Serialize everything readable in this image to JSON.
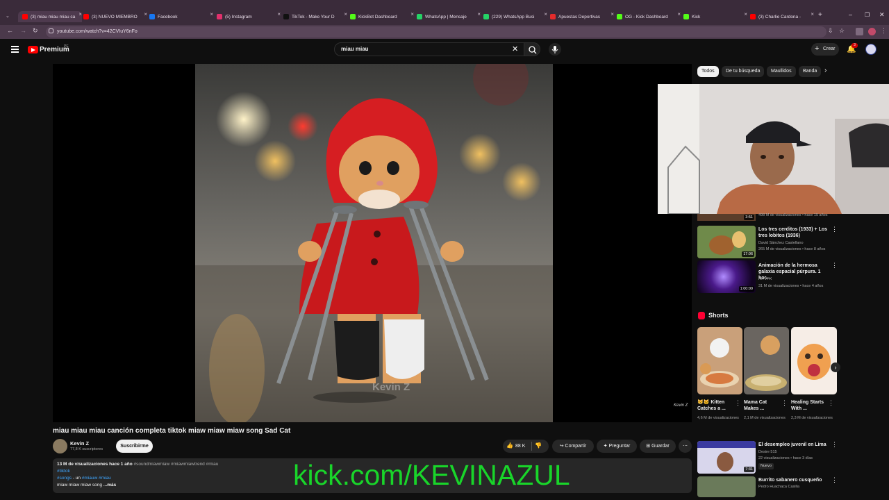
{
  "browser": {
    "tabs": [
      {
        "label": "(3) miau miau miau ca",
        "color": "#ff0000",
        "active": true
      },
      {
        "label": "(3) NUEVO MIEMBRO",
        "color": "#ff0000"
      },
      {
        "label": "Facebook",
        "color": "#1877f2"
      },
      {
        "label": "(5) Instagram",
        "color": "#e1306c"
      },
      {
        "label": "TikTok - Make Your D",
        "color": "#111111"
      },
      {
        "label": "KickBot Dashboard",
        "color": "#53fc18"
      },
      {
        "label": "WhatsApp | Mensaje",
        "color": "#25d366"
      },
      {
        "label": "(229) WhatsApp Busi",
        "color": "#25d366"
      },
      {
        "label": "Apuestas Deportivas",
        "color": "#e52b2b"
      },
      {
        "label": "OG - Kick Dashboard",
        "color": "#53fc18"
      },
      {
        "label": "Kick",
        "color": "#53fc18"
      },
      {
        "label": "(3) Charlie Cardona -",
        "color": "#ff0000"
      }
    ],
    "url": "youtube.com/watch?v=42CVIuY6nFo"
  },
  "header": {
    "logo_text": "Premium",
    "country": "PE",
    "search_value": "miau miau",
    "create_label": "Crear",
    "notif_count": "3"
  },
  "player": {
    "watermark": "Kevin Z"
  },
  "chips": [
    "Todos",
    "De tu búsqueda",
    "Maullidos",
    "Banda"
  ],
  "related": [
    {
      "title": "Los tres cerditos (1933) + Los tres lobitos (1936)",
      "channel": "David Sánchez Castellano",
      "meta": "265 M de visualizaciones • hace 8 años",
      "duration": "17:06"
    },
    {
      "title": "Animación de la hermosa galaxia espacial púrpura. 1 hor...",
      "channel": "AA VFX",
      "meta": "31 M de visualizaciones • hace 4 años",
      "duration": "1:00:00"
    }
  ],
  "top_partial": {
    "meta": "498 M de visualizaciones • hace 15 años",
    "duration": "3:51"
  },
  "shorts": {
    "heading": "Shorts",
    "items": [
      {
        "title": "😸🐱 Kitten Catches a ...",
        "views": "4,6 M de visualizaciones"
      },
      {
        "title": "Mama Cat Makes ...",
        "views": "2,1 M de visualizaciones"
      },
      {
        "title": "Healing Starts With ...",
        "views": "2,3 M de visualizaciones"
      }
    ]
  },
  "related2": [
    {
      "title": "El desempleo juvenil en Lima",
      "channel": "Desire 515",
      "meta": "22 visualizaciones • hace 3 días",
      "badge": "Nuevo",
      "duration": "7:31"
    },
    {
      "title": "Burrito sabanero cusqueño",
      "channel": "Pedro Huachaca Casilla"
    }
  ],
  "video": {
    "title": "miau miau miau canción completa tiktok miaw miaw miaw song Sad Cat",
    "channel": "Kevin Z",
    "subs": "77,8 K suscriptores",
    "subscribe": "Suscribirme",
    "likes": "88 K",
    "share": "Compartir",
    "ask": "Preguntar",
    "save": "Guardar",
    "views_line": "13 M de visualizaciones  hace 1 año",
    "hashtags_line": "#soundmiawmiaw #miawmiawtrend #miau",
    "tag1": "#tiktok",
    "line3a": "#songs",
    "line3b": " - un ",
    "line3c": "#miauw #miau",
    "line4": "miaw miaw miaw song",
    "more": " ...más"
  },
  "overlay": {
    "kick_text": "kick.com/KEVINAZUL"
  }
}
